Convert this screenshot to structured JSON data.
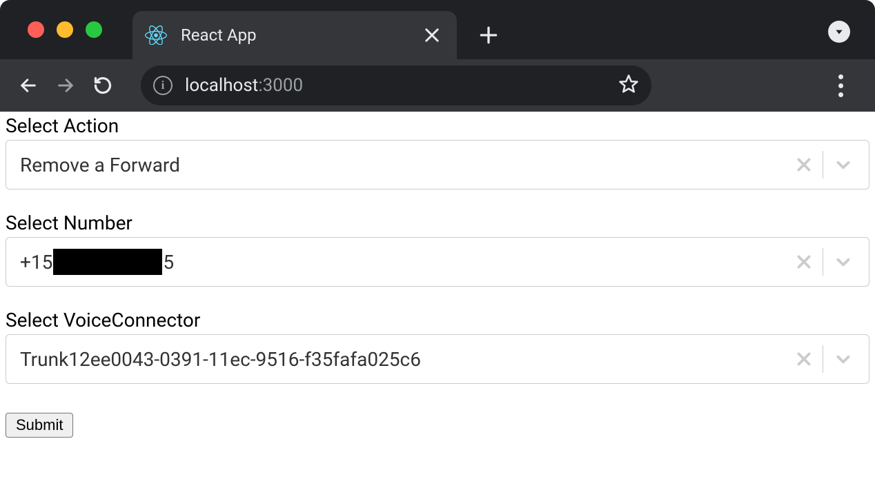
{
  "browser": {
    "tab_title": "React App",
    "url_host": "localhost",
    "url_port": ":3000"
  },
  "form": {
    "action": {
      "label": "Select Action",
      "value": "Remove a Forward"
    },
    "number": {
      "label": "Select Number",
      "value_prefix": "+15",
      "value_suffix": "5"
    },
    "voice_connector": {
      "label": "Select VoiceConnector",
      "value": "Trunk12ee0043-0391-11ec-9516-f35fafa025c6"
    },
    "submit_label": "Submit"
  }
}
